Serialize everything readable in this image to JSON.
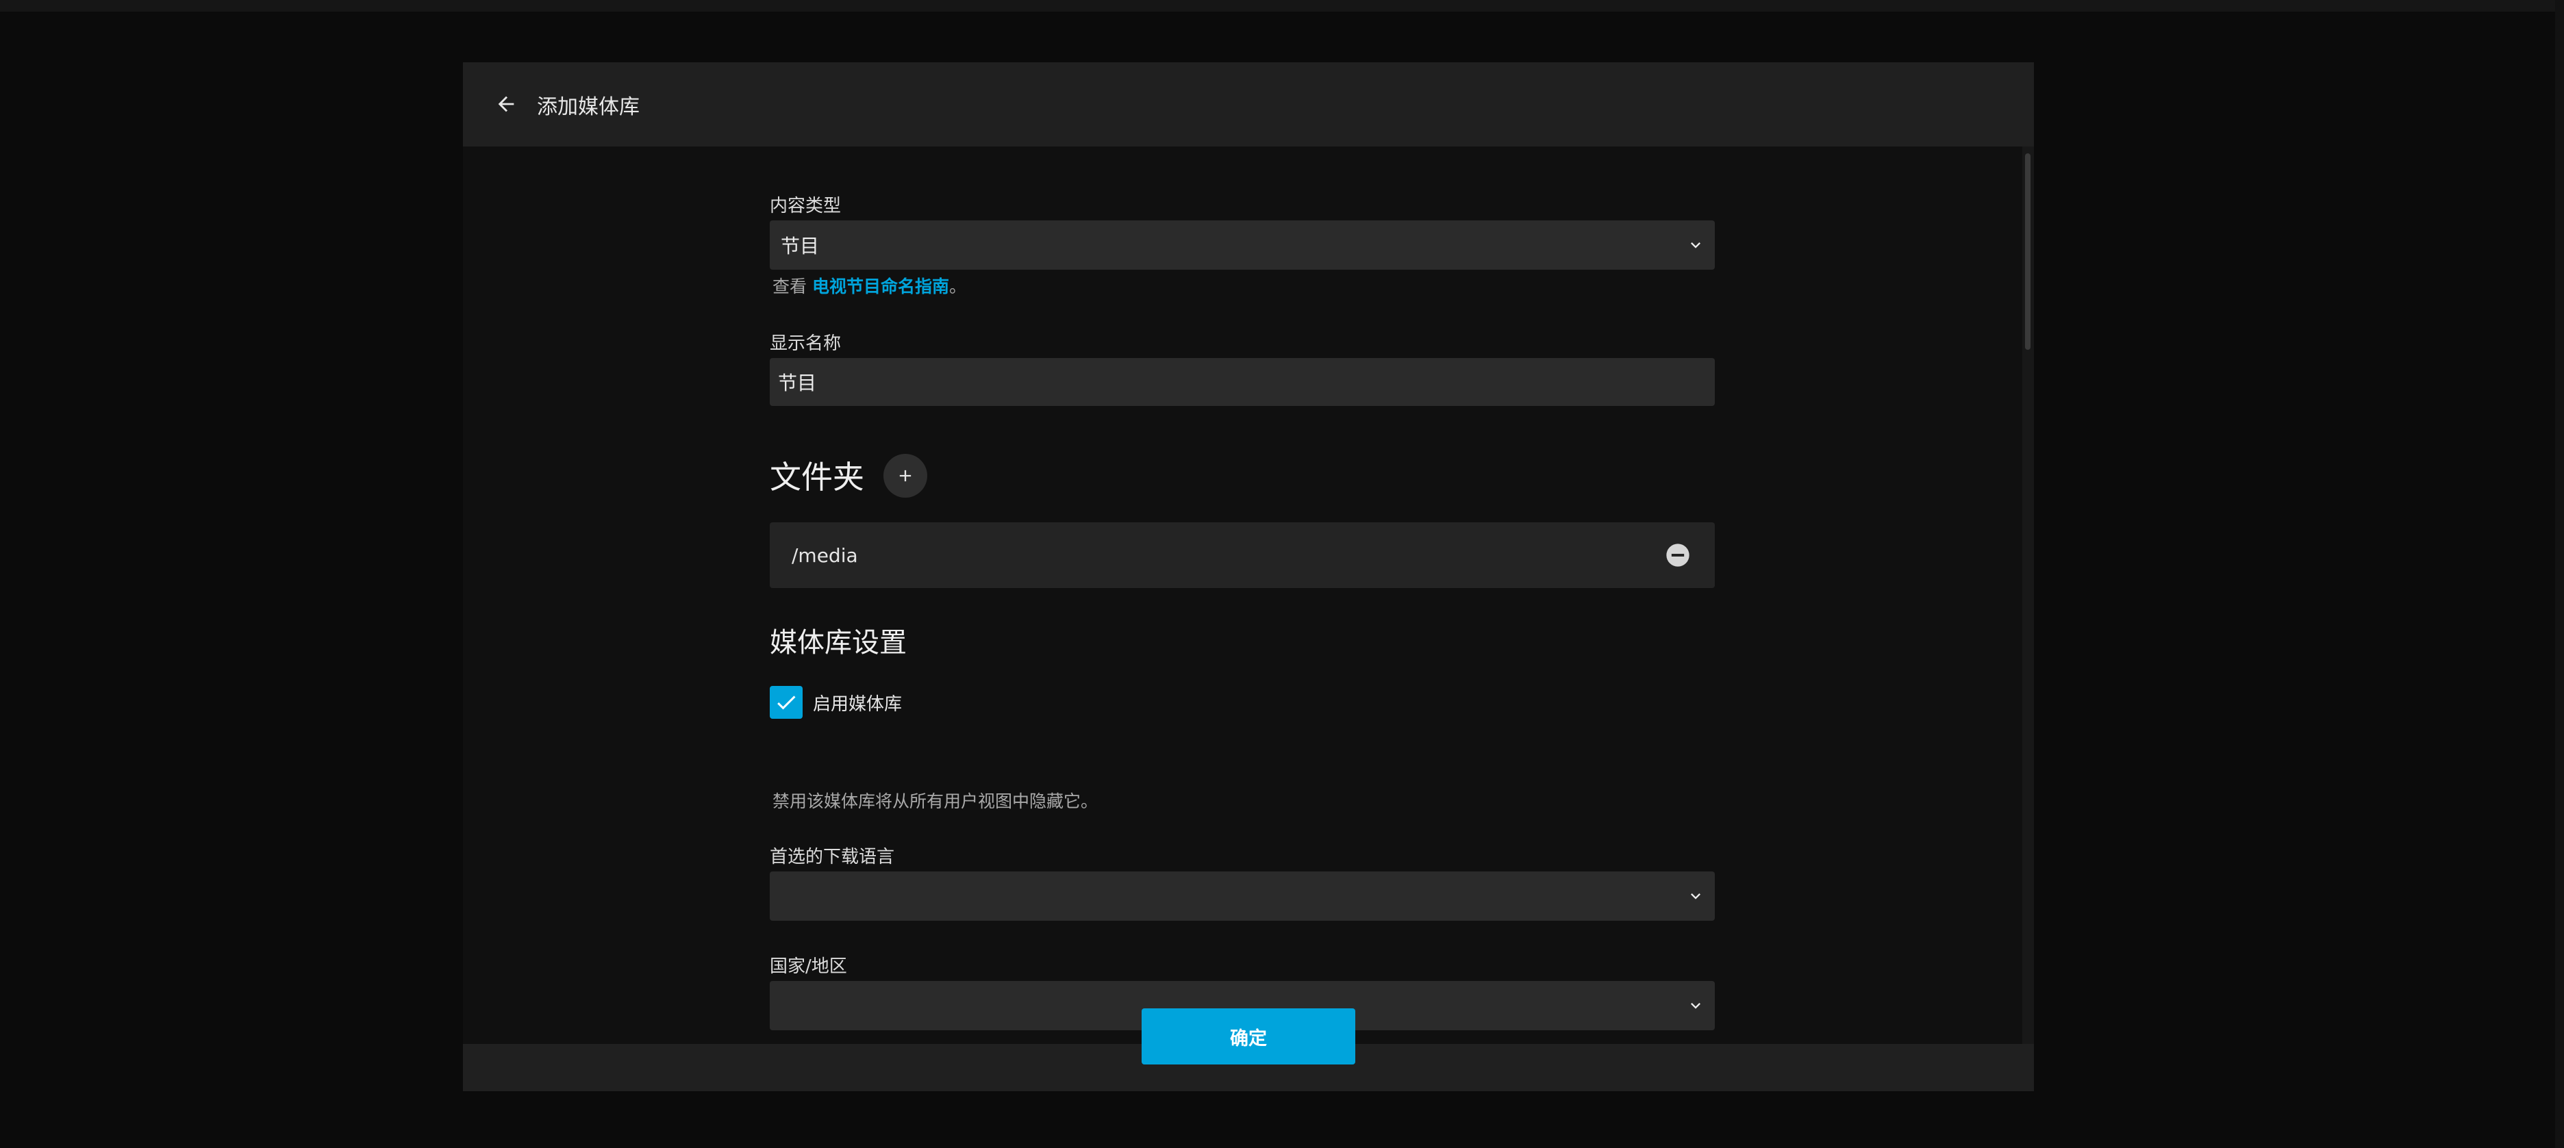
{
  "dialog": {
    "title": "添加媒体库"
  },
  "form": {
    "content_type": {
      "label": "内容类型",
      "value": "节目",
      "helper_prefix": "查看 ",
      "helper_link": "电视节目命名指南",
      "helper_suffix": "。"
    },
    "display_name": {
      "label": "显示名称",
      "value": "节目"
    },
    "folders": {
      "title": "文件夹",
      "items": [
        {
          "path": "/media"
        }
      ]
    },
    "library_settings": {
      "title": "媒体库设置",
      "enable_library": {
        "label": "启用媒体库",
        "checked": true,
        "helper": "禁用该媒体库将从所有用户视图中隐藏它。"
      },
      "preferred_language": {
        "label": "首选的下载语言",
        "value": ""
      },
      "country_region": {
        "label": "国家/地区",
        "value": ""
      }
    }
  },
  "footer": {
    "ok_label": "确定"
  },
  "colors": {
    "accent": "#00a4dc",
    "background": "#101010",
    "panel": "#202020",
    "field": "#2b2b2b"
  },
  "icons": {
    "back": "arrow-left-icon",
    "dropdown": "chevron-down-icon",
    "add": "plus-icon",
    "remove": "minus-circle-icon",
    "check": "check-icon"
  }
}
